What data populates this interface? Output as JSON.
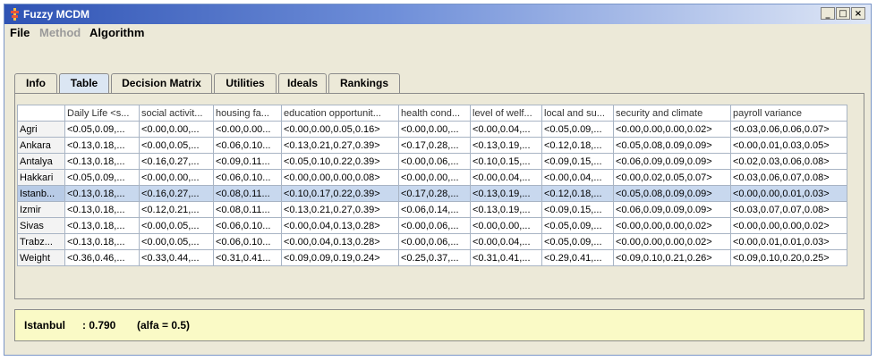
{
  "window": {
    "title": "Fuzzy MCDM",
    "buttons": [
      "_",
      "□",
      "×"
    ]
  },
  "menu": {
    "items": [
      "File",
      "Method",
      "Algorithm"
    ]
  },
  "tabs": [
    "Info",
    "Table",
    "Decision Matrix",
    "Utilities",
    "Ideals",
    "Rankings"
  ],
  "active_tab": "Table",
  "table": {
    "columns": [
      "",
      "Daily Life <s...",
      "social activit...",
      "housing fa...",
      "education opportunit...",
      "health cond...",
      "level of welf...",
      "local and su...",
      "security and climate",
      "payroll variance"
    ],
    "rows": [
      [
        "Agri",
        "<0.05,0.09,...",
        "<0.00,0.00,...",
        "<0.00,0.00...",
        "<0.00,0.00,0.05,0.16>",
        "<0.00,0.00,...",
        "<0.00,0.04,...",
        "<0.05,0.09,...",
        "<0.00,0.00,0.00,0.02>",
        "<0.03,0.06,0.06,0.07>"
      ],
      [
        "Ankara",
        "<0.13,0.18,...",
        "<0.00,0.05,...",
        "<0.06,0.10...",
        "<0.13,0.21,0.27,0.39>",
        "<0.17,0.28,...",
        "<0.13,0.19,...",
        "<0.12,0.18,...",
        "<0.05,0.08,0.09,0.09>",
        "<0.00,0.01,0.03,0.05>"
      ],
      [
        "Antalya",
        "<0.13,0.18,...",
        "<0.16,0.27,...",
        "<0.09,0.11...",
        "<0.05,0.10,0.22,0.39>",
        "<0.00,0.06,...",
        "<0.10,0.15,...",
        "<0.09,0.15,...",
        "<0.06,0.09,0.09,0.09>",
        "<0.02,0.03,0.06,0.08>"
      ],
      [
        "Hakkari",
        "<0.05,0.09,...",
        "<0.00,0.00,...",
        "<0.06,0.10...",
        "<0.00,0.00,0.00,0.08>",
        "<0.00,0.00,...",
        "<0.00,0.04,...",
        "<0.00,0.04,...",
        "<0.00,0.02,0.05,0.07>",
        "<0.03,0.06,0.07,0.08>"
      ],
      [
        "Istanb...",
        "<0.13,0.18,...",
        "<0.16,0.27,...",
        "<0.08,0.11...",
        "<0.10,0.17,0.22,0.39>",
        "<0.17,0.28,...",
        "<0.13,0.19,...",
        "<0.12,0.18,...",
        "<0.05,0.08,0.09,0.09>",
        "<0.00,0.00,0.01,0.03>"
      ],
      [
        "Izmir",
        "<0.13,0.18,...",
        "<0.12,0.21,...",
        "<0.08,0.11...",
        "<0.13,0.21,0.27,0.39>",
        "<0.06,0.14,...",
        "<0.13,0.19,...",
        "<0.09,0.15,...",
        "<0.06,0.09,0.09,0.09>",
        "<0.03,0.07,0.07,0.08>"
      ],
      [
        "Sivas",
        "<0.13,0.18,...",
        "<0.00,0.05,...",
        "<0.06,0.10...",
        "<0.00,0.04,0.13,0.28>",
        "<0.00,0.06,...",
        "<0.00,0.00,...",
        "<0.05,0.09,...",
        "<0.00,0.00,0.00,0.02>",
        "<0.00,0.00,0.00,0.02>"
      ],
      [
        "Trabz...",
        "<0.13,0.18,...",
        "<0.00,0.05,...",
        "<0.06,0.10...",
        "<0.00,0.04,0.13,0.28>",
        "<0.00,0.06,...",
        "<0.00,0.04,...",
        "<0.05,0.09,...",
        "<0.00,0.00,0.00,0.02>",
        "<0.00,0.01,0.01,0.03>"
      ],
      [
        "Weight",
        "<0.36,0.46,...",
        "<0.33,0.44,...",
        "<0.31,0.41...",
        "<0.09,0.09,0.19,0.24>",
        "<0.25,0.37,...",
        "<0.31,0.41,...",
        "<0.29,0.41,...",
        "<0.09,0.10,0.21,0.26>",
        "<0.09,0.10,0.20,0.25>"
      ]
    ],
    "selected_row": 4
  },
  "result": {
    "name": "Istanbul",
    "value": ": 0.790",
    "alfa": "(alfa = 0.5)"
  },
  "colors": {
    "title_bar": "#2f53b4",
    "selected_row": "#c8d8ee",
    "status_bg": "#fafac6"
  }
}
